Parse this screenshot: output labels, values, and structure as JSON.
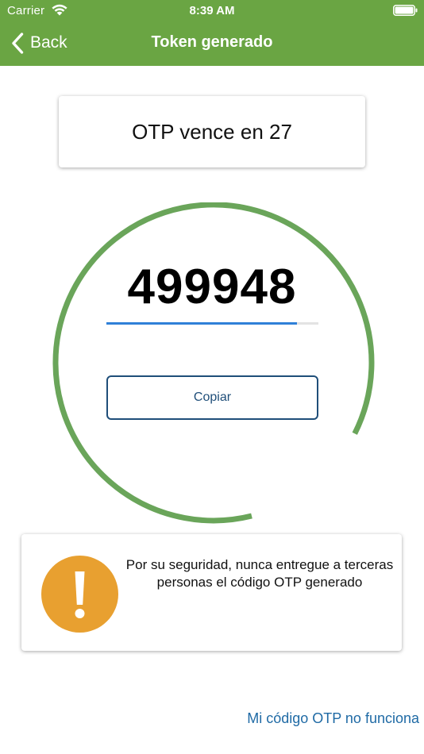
{
  "status_bar": {
    "carrier": "Carrier",
    "time": "8:39 AM"
  },
  "nav": {
    "back_label": "Back",
    "title": "Token generado"
  },
  "expiry": {
    "text": "OTP vence en 27"
  },
  "otp": {
    "code": "499948",
    "progress_percent": 90,
    "copy_label": "Copiar"
  },
  "warning": {
    "message": "Por su seguridad, nunca entregue a terceras personas el código OTP generado"
  },
  "footer": {
    "help_link": "Mi código OTP no funciona"
  },
  "colors": {
    "header_green": "#6aa543",
    "ring_green": "#6aa55a",
    "progress_blue": "#2f80d8",
    "button_border": "#1f4e79",
    "warning_orange": "#e8a030",
    "link_blue": "#1f6aa5"
  },
  "icons": {
    "wifi": "wifi-icon",
    "battery": "battery-icon",
    "back": "chevron-left-icon",
    "warning": "exclamation-icon"
  }
}
